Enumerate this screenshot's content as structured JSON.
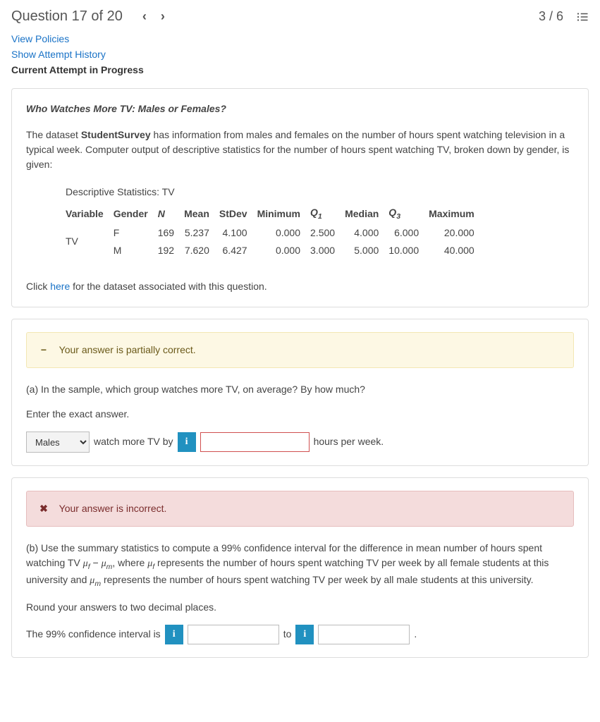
{
  "header": {
    "title": "Question 17 of 20",
    "score": "3 / 6"
  },
  "links": {
    "view_policies": "View Policies",
    "show_history": "Show Attempt History",
    "current_attempt": "Current Attempt in Progress"
  },
  "intro": {
    "title": "Who Watches More TV: Males or Females?",
    "text_pre": "The dataset ",
    "dataset_name": "StudentSurvey",
    "text_post": " has information from males and females on the number of hours spent watching television in a typical week. Computer output of descriptive statistics for the number of hours spent watching TV, broken down by gender, is given:",
    "stats_caption": "Descriptive Statistics: TV",
    "headers": {
      "variable": "Variable",
      "gender": "Gender",
      "n": "N",
      "mean": "Mean",
      "stdev": "StDev",
      "min": "Minimum",
      "q1": "Q",
      "q1_sub": "1",
      "median": "Median",
      "q3": "Q",
      "q3_sub": "3",
      "max": "Maximum"
    },
    "rows": [
      {
        "variable": "TV",
        "gender": "F",
        "n": "169",
        "mean": "5.237",
        "stdev": "4.100",
        "min": "0.000",
        "q1": "2.500",
        "median": "4.000",
        "q3": "6.000",
        "max": "20.000"
      },
      {
        "variable": "",
        "gender": "M",
        "n": "192",
        "mean": "7.620",
        "stdev": "6.427",
        "min": "0.000",
        "q1": "3.000",
        "median": "5.000",
        "q3": "10.000",
        "max": "40.000"
      }
    ],
    "click_pre": "Click ",
    "click_link": "here",
    "click_post": " for the dataset associated with this question."
  },
  "partA": {
    "feedback": "Your answer is partially correct.",
    "prompt": "(a) In the sample, which group watches more TV, on average? By how much?",
    "enter_exact": "Enter the exact answer.",
    "dropdown_value": "Males",
    "mid_text": "watch more TV by",
    "tail_text": "hours per week."
  },
  "partB": {
    "feedback": "Your answer is incorrect.",
    "prompt_pre": "(b) Use the summary statistics to compute a ",
    "pct": "99%",
    "prompt_mid1": " confidence interval for the difference in mean number of hours spent watching TV ",
    "prompt_mid2": ", where ",
    "prompt_mid3": " represents the number of hours spent watching TV per week by all female students at this university and ",
    "prompt_mid4": " represents the number of hours spent watching TV per week by all male students at this university.",
    "round": "Round your answers to two decimal places.",
    "ci_pre": "The ",
    "ci_label": " confidence interval is",
    "to": "to",
    "period": "."
  }
}
